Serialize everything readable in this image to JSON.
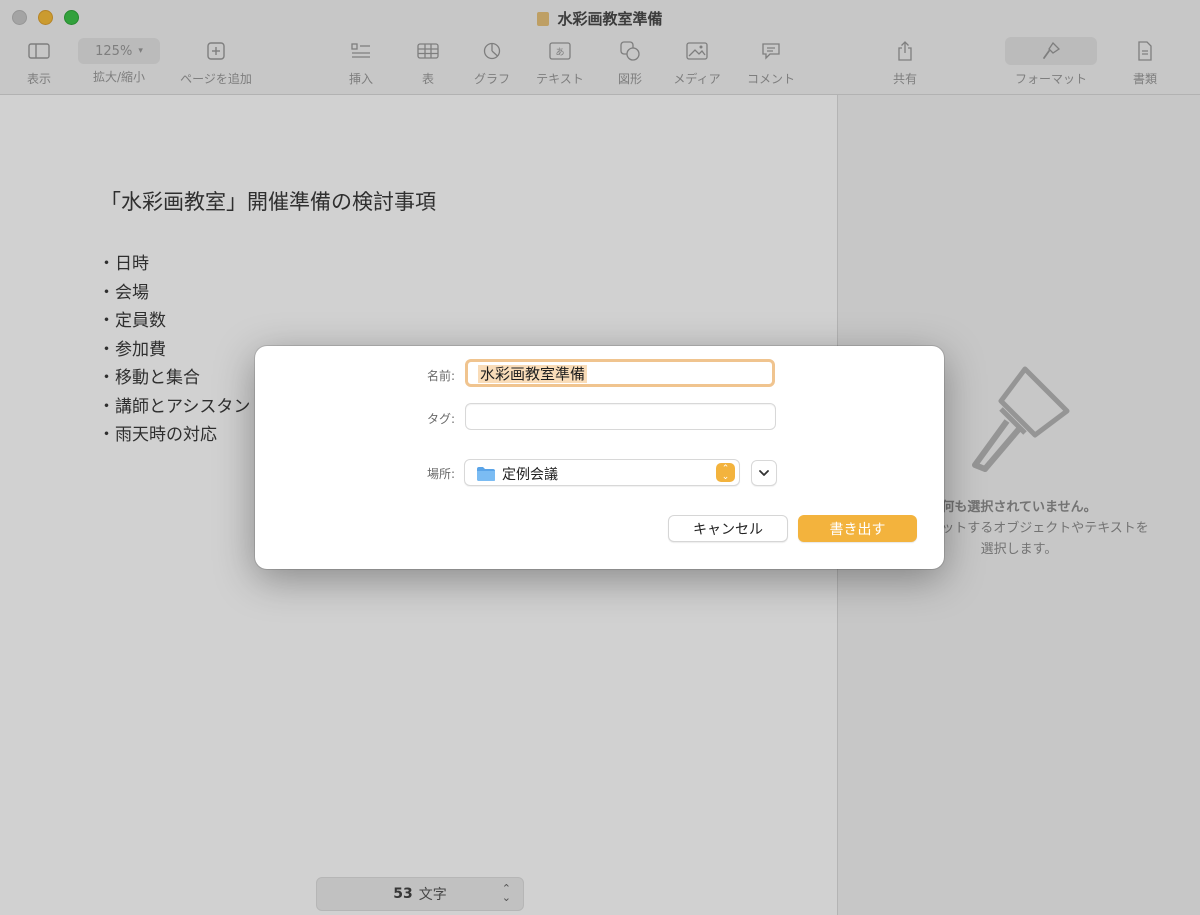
{
  "window": {
    "title": "水彩画教室準備"
  },
  "toolbar": {
    "view": "表示",
    "zoom_value": "125%",
    "zoom": "拡大/縮小",
    "add_page": "ページを追加",
    "insert": "挿入",
    "table": "表",
    "chart": "グラフ",
    "text": "テキスト",
    "shape": "図形",
    "media": "メディア",
    "comment": "コメント",
    "share": "共有",
    "format": "フォーマット",
    "document": "書類"
  },
  "document": {
    "heading": "「水彩画教室」開催準備の検討事項",
    "bullets": [
      "日時",
      "会場",
      "定員数",
      "参加費",
      "移動と集合",
      "講師とアシスタント",
      "雨天時の対応"
    ]
  },
  "status": {
    "word_count": "53",
    "word_unit": "文字"
  },
  "sidebar": {
    "empty_title": "何も選択されていません。",
    "empty_hint_1": "フォーマットするオブジェクトやテキストを",
    "empty_hint_2": "選択します。"
  },
  "export_dialog": {
    "name_label": "名前:",
    "name_value": "水彩画教室準備",
    "tags_label": "タグ:",
    "tags_value": "",
    "location_label": "場所:",
    "location_value": "定例会議",
    "cancel": "キャンセル",
    "export": "書き出す"
  },
  "colors": {
    "accent": "#f3b33d",
    "focus_ring": "#f0c48f",
    "folder": "#5aa4e8"
  }
}
